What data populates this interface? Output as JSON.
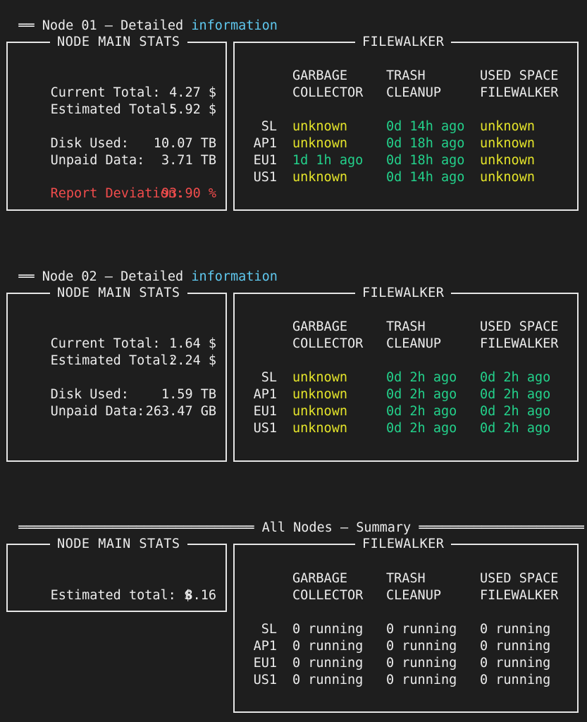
{
  "node01": {
    "heading_bar": "══",
    "heading_text": "Node 01 – Detailed",
    "heading_link": "information",
    "main": {
      "title": "NODE MAIN STATS",
      "current_total_label": "Current Total:",
      "current_total_value": "4.27 $",
      "estimated_total_label": "Estimated Total:",
      "estimated_total_value": "5.92 $",
      "disk_used_label": "Disk Used:",
      "disk_used_value": "10.07 TB",
      "unpaid_label": "Unpaid Data:",
      "unpaid_value": "3.71 TB",
      "deviation_label": "Report Deviation:",
      "deviation_value": "93.90 %"
    },
    "fw": {
      "title": "FILEWALKER",
      "col1_a": "GARBAGE",
      "col1_b": "COLLECTOR",
      "col2_a": "TRASH",
      "col2_b": "CLEANUP",
      "col3_a": "USED SPACE",
      "col3_b": "FILEWALKER",
      "rows": [
        {
          "sat": "SL",
          "gc": "unknown",
          "trash": "0d 14h ago",
          "used": "unknown"
        },
        {
          "sat": "AP1",
          "gc": "unknown",
          "trash": "0d 18h ago",
          "used": "unknown"
        },
        {
          "sat": "EU1",
          "gc": "1d 1h ago",
          "trash": "0d 18h ago",
          "used": "unknown"
        },
        {
          "sat": "US1",
          "gc": "unknown",
          "trash": "0d 14h ago",
          "used": "unknown"
        }
      ]
    }
  },
  "node02": {
    "heading_bar": "══",
    "heading_text": "Node 02 – Detailed",
    "heading_link": "information",
    "main": {
      "title": "NODE MAIN STATS",
      "current_total_label": "Current Total:",
      "current_total_value": "1.64 $",
      "estimated_total_label": "Estimated Total:",
      "estimated_total_value": "2.24 $",
      "disk_used_label": "Disk Used:",
      "disk_used_value": "1.59 TB",
      "unpaid_label": "Unpaid Data:",
      "unpaid_value": "263.47 GB"
    },
    "fw": {
      "title": "FILEWALKER",
      "col1_a": "GARBAGE",
      "col1_b": "COLLECTOR",
      "col2_a": "TRASH",
      "col2_b": "CLEANUP",
      "col3_a": "USED SPACE",
      "col3_b": "FILEWALKER",
      "rows": [
        {
          "sat": "SL",
          "gc": "unknown",
          "trash": "0d 2h ago",
          "used": "0d 2h ago"
        },
        {
          "sat": "AP1",
          "gc": "unknown",
          "trash": "0d 2h ago",
          "used": "0d 2h ago"
        },
        {
          "sat": "EU1",
          "gc": "unknown",
          "trash": "0d 2h ago",
          "used": "0d 2h ago"
        },
        {
          "sat": "US1",
          "gc": "unknown",
          "trash": "0d 2h ago",
          "used": "0d 2h ago"
        }
      ]
    }
  },
  "summary": {
    "heading_left_bar": "══════════════════════════════",
    "heading_text": "All Nodes – Summary",
    "heading_right_bar": "══════════════════════════",
    "main": {
      "title": "NODE MAIN STATS",
      "estimated_label": "Estimated total: $",
      "estimated_value": "8.16"
    },
    "fw": {
      "title": "FILEWALKER",
      "col1_a": "GARBAGE",
      "col1_b": "COLLECTOR",
      "col2_a": "TRASH",
      "col2_b": "CLEANUP",
      "col3_a": "USED SPACE",
      "col3_b": "FILEWALKER",
      "rows": [
        {
          "sat": "SL",
          "gc": "0 running",
          "trash": "0 running",
          "used": "0 running"
        },
        {
          "sat": "AP1",
          "gc": "0 running",
          "trash": "0 running",
          "used": "0 running"
        },
        {
          "sat": "EU1",
          "gc": "0 running",
          "trash": "0 running",
          "used": "0 running"
        },
        {
          "sat": "US1",
          "gc": "0 running",
          "trash": "0 running",
          "used": "0 running"
        }
      ]
    }
  },
  "colors": {
    "background": "#1e1e1e",
    "text": "#ececec",
    "yellow": "#e5e52a",
    "green": "#23d18b",
    "red": "#f14c4c",
    "cyan": "#5fc8ef"
  }
}
